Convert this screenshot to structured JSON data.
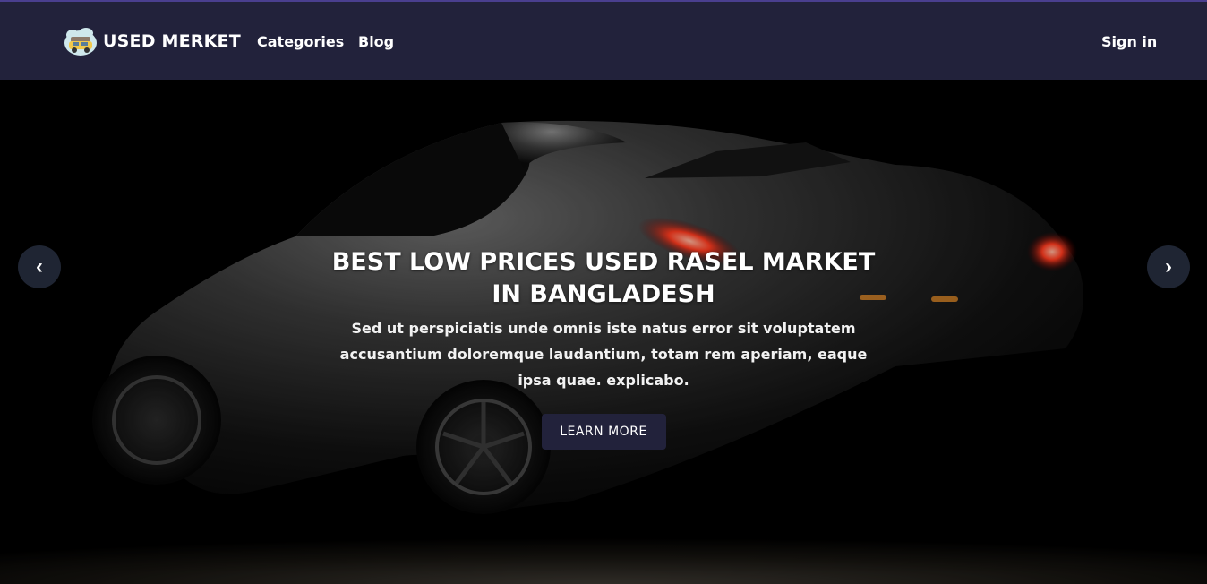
{
  "nav": {
    "brand_name": "USED MERKET",
    "brand_logo_icon": "car-logo-icon",
    "links": [
      {
        "label": "Categories"
      },
      {
        "label": "Blog"
      }
    ],
    "signin_label": "Sign in"
  },
  "hero": {
    "title": "BEST LOW PRICES USED RASEL MARKET IN BANGLADESH",
    "description": "Sed ut perspiciatis unde omnis iste natus error sit voluptatem accusantium doloremque laudantium, totam rem aperiam, eaque ipsa quae. explicabo.",
    "button_label": "LEARN MORE",
    "prev_label": "‹",
    "next_label": "›",
    "background_image": "dark-sports-car-photo"
  },
  "colors": {
    "navbar_bg": "#22223b",
    "button_bg": "#22223b",
    "hero_bg": "#000000",
    "taillight": "#ff3b1f"
  }
}
